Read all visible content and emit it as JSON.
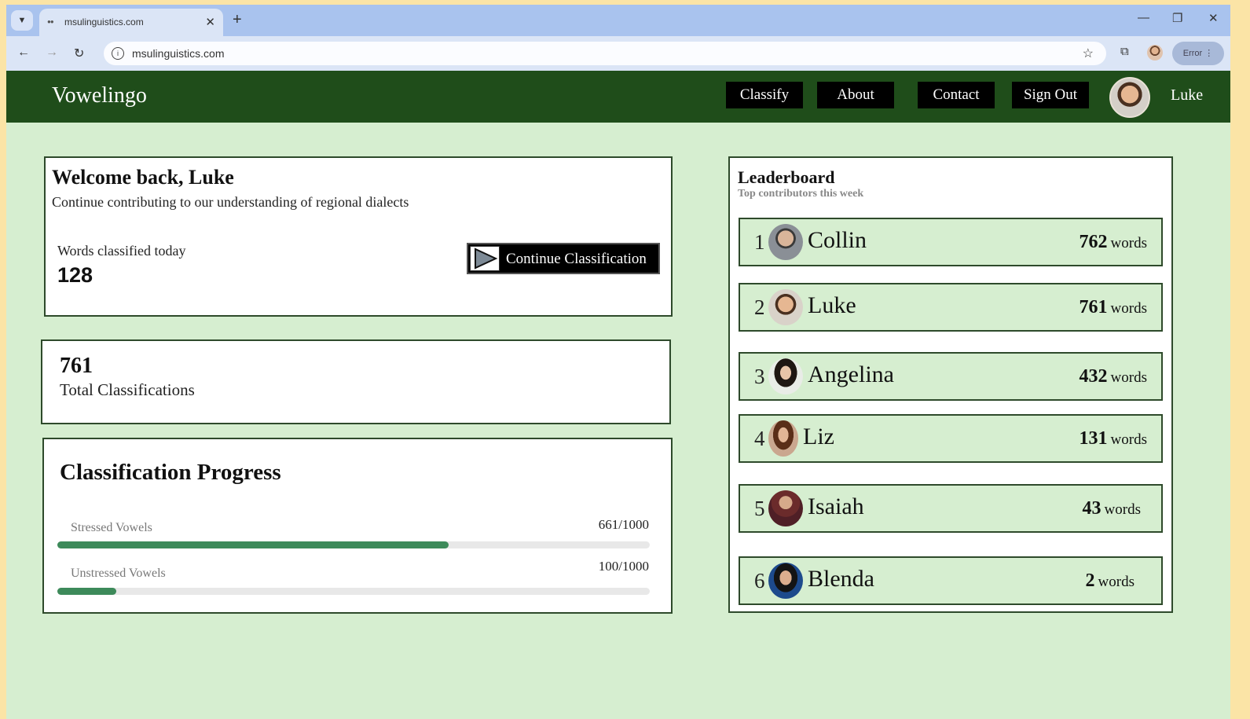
{
  "browser": {
    "tab_title": "msulinguistics.com",
    "url": "msulinguistics.com",
    "profile_label": "Error"
  },
  "app": {
    "brand": "Vowelingo",
    "nav": [
      "Classify",
      "About",
      "Contact",
      "Sign Out"
    ],
    "user": "Luke"
  },
  "welcome": {
    "title": "Welcome back, Luke",
    "subtitle": "Continue contributing to our understanding of regional dialects",
    "today_label": "Words classified today",
    "today_value": "128",
    "continue_label": "Continue Classification"
  },
  "totals": {
    "value": "761",
    "label": "Total Classifications"
  },
  "progress": {
    "title": "Classification Progress",
    "items": [
      {
        "label": "Stressed Vowels",
        "count": "661/1000",
        "fraction": 0.661
      },
      {
        "label": "Unstressed Vowels",
        "count": "100/1000",
        "fraction": 0.1
      }
    ]
  },
  "leaderboard": {
    "title": "Leaderboard",
    "subtitle": "Top contributors this week",
    "rows": [
      {
        "rank": "1",
        "name": "Collin",
        "score": "762",
        "unit": "words"
      },
      {
        "rank": "2",
        "name": "Luke",
        "score": "761",
        "unit": "words"
      },
      {
        "rank": "3",
        "name": "Angelina",
        "score": "432",
        "unit": "words"
      },
      {
        "rank": "4",
        "name": "Liz",
        "score": "131",
        "unit": "words"
      },
      {
        "rank": "5",
        "name": "Isaiah",
        "score": "43",
        "unit": "words"
      },
      {
        "rank": "6",
        "name": "Blenda",
        "score": "2",
        "unit": "words"
      }
    ]
  },
  "colors": {
    "header_bg": "#1f4d1a",
    "page_bg": "#d6eed0",
    "progress_fill": "#3d8a5a"
  }
}
